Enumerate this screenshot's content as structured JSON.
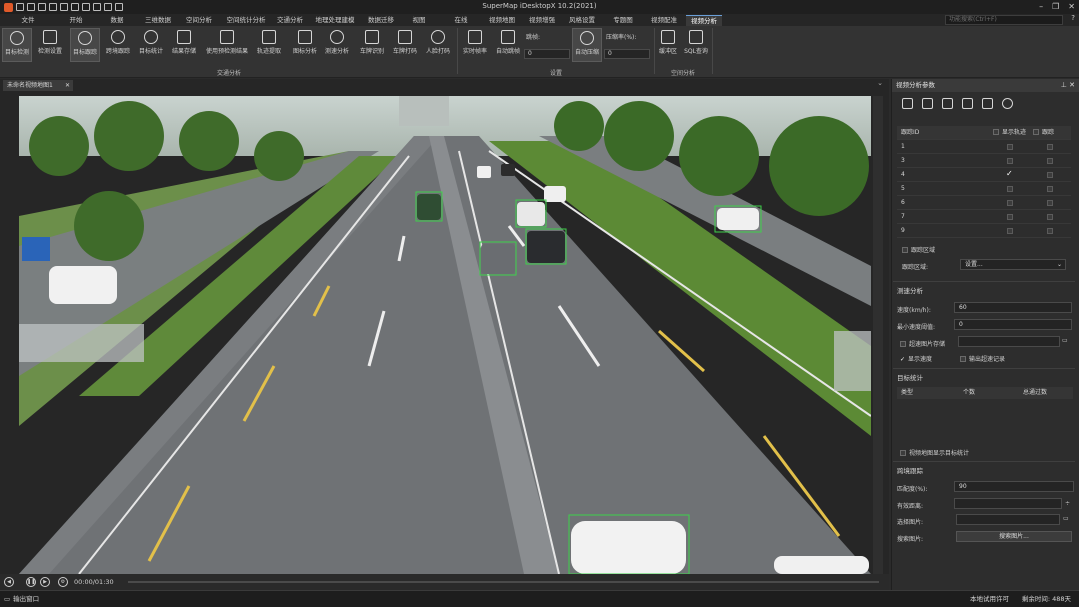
{
  "window": {
    "title": "SuperMap iDesktopX 10.2(2021)"
  },
  "menu": {
    "tabs": [
      "文件",
      "开始",
      "数据",
      "三维数据",
      "空间分析",
      "空间统计分析",
      "交通分析",
      "地理处理建模",
      "数据迁移",
      "视图",
      "在线",
      "视频地图",
      "视频增强",
      "风格设置",
      "专题图",
      "视频配准",
      "视频分析"
    ],
    "active_tab": "视频分析",
    "search_placeholder": "功能搜索(Ctrl+F)"
  },
  "ribbon": {
    "buttons": [
      "目标检测",
      "检测设置",
      "目标跟踪",
      "跨境跟踪",
      "目标统计",
      "结果存储",
      "使用预检测结果",
      "轨迹提取",
      "图标分析",
      "测速分析",
      "车牌识别",
      "车牌打码",
      "人脸打码",
      "实时帧率",
      "自动跳帧",
      "自动压缩",
      "缓冲区",
      "SQL查询"
    ],
    "jump_frame_label": "跳帧:",
    "jump_frame_value": "0",
    "compress_label": "压缩率(%):",
    "compress_value": "0",
    "groups": {
      "traffic": "交通分析",
      "settings": "设置",
      "spatial": "空间分析"
    }
  },
  "document": {
    "tab_label": "未命名视频地图1"
  },
  "player": {
    "time": "00:00/01:30"
  },
  "panel": {
    "title": "视频分析参数",
    "track_table": {
      "col_id": "跟踪ID",
      "col_show_track": "显示轨迹",
      "col_track": "跟踪",
      "rows": [
        {
          "id": "1",
          "checked": false
        },
        {
          "id": "3",
          "checked": false
        },
        {
          "id": "4",
          "checked": true
        },
        {
          "id": "5",
          "checked": false
        },
        {
          "id": "6",
          "checked": false
        },
        {
          "id": "7",
          "checked": false
        },
        {
          "id": "9",
          "checked": false
        }
      ]
    },
    "track_area": {
      "checkbox": "跟踪区域",
      "label": "跟踪区域:",
      "value": "设置..."
    },
    "speed": {
      "section": "测速分析",
      "speed_label": "速度(km/h):",
      "speed_value": "60",
      "min_speed_label": "最小速度阈值:",
      "min_speed_value": "0",
      "overspeed_store": "超速图片存储",
      "show_speed": "显示速度",
      "export_overspeed": "输出超速记录"
    },
    "stats": {
      "section": "目标统计",
      "col_type": "类型",
      "col_count": "个数",
      "col_passed": "总通过数",
      "show_on_map": "视频地图显示目标统计"
    },
    "cross": {
      "section": "跨境跟踪",
      "match_label": "匹配度(%):",
      "match_value": "90",
      "valid_dist_label": "有效距离:",
      "select_image_label": "选择图片:",
      "search_image_label": "搜索图片:",
      "search_button": "搜索图片..."
    }
  },
  "status": {
    "left": "输出窗口",
    "license": "本地试用许可",
    "remaining": "剩余时间: 488天"
  },
  "colors": {
    "accent": "#6a9fd8",
    "detection_box": "#3dd14a"
  }
}
